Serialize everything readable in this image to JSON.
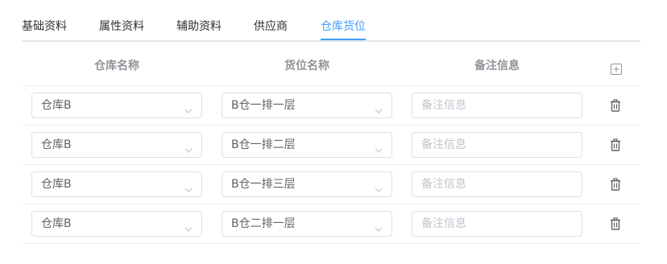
{
  "tabs": [
    {
      "label": "基础资料",
      "active": false
    },
    {
      "label": "属性资料",
      "active": false
    },
    {
      "label": "辅助资料",
      "active": false
    },
    {
      "label": "供应商",
      "active": false
    },
    {
      "label": "仓库货位",
      "active": true
    }
  ],
  "colors": {
    "accent": "#409eff",
    "border": "#dcdfe6",
    "header_text": "#909399"
  },
  "table": {
    "headers": {
      "warehouse": "仓库名称",
      "location": "货位名称",
      "remark": "备注信息"
    },
    "add_icon": "plus-square-icon",
    "delete_icon": "trash-icon",
    "rows": [
      {
        "warehouse": "仓库B",
        "location": "B仓一排一层",
        "remark_value": "",
        "remark_placeholder": "备注信息"
      },
      {
        "warehouse": "仓库B",
        "location": "B仓一排二层",
        "remark_value": "",
        "remark_placeholder": "备注信息"
      },
      {
        "warehouse": "仓库B",
        "location": "B仓一排三层",
        "remark_value": "",
        "remark_placeholder": "备注信息"
      },
      {
        "warehouse": "仓库B",
        "location": "B仓二排一层",
        "remark_value": "",
        "remark_placeholder": "备注信息"
      }
    ]
  }
}
